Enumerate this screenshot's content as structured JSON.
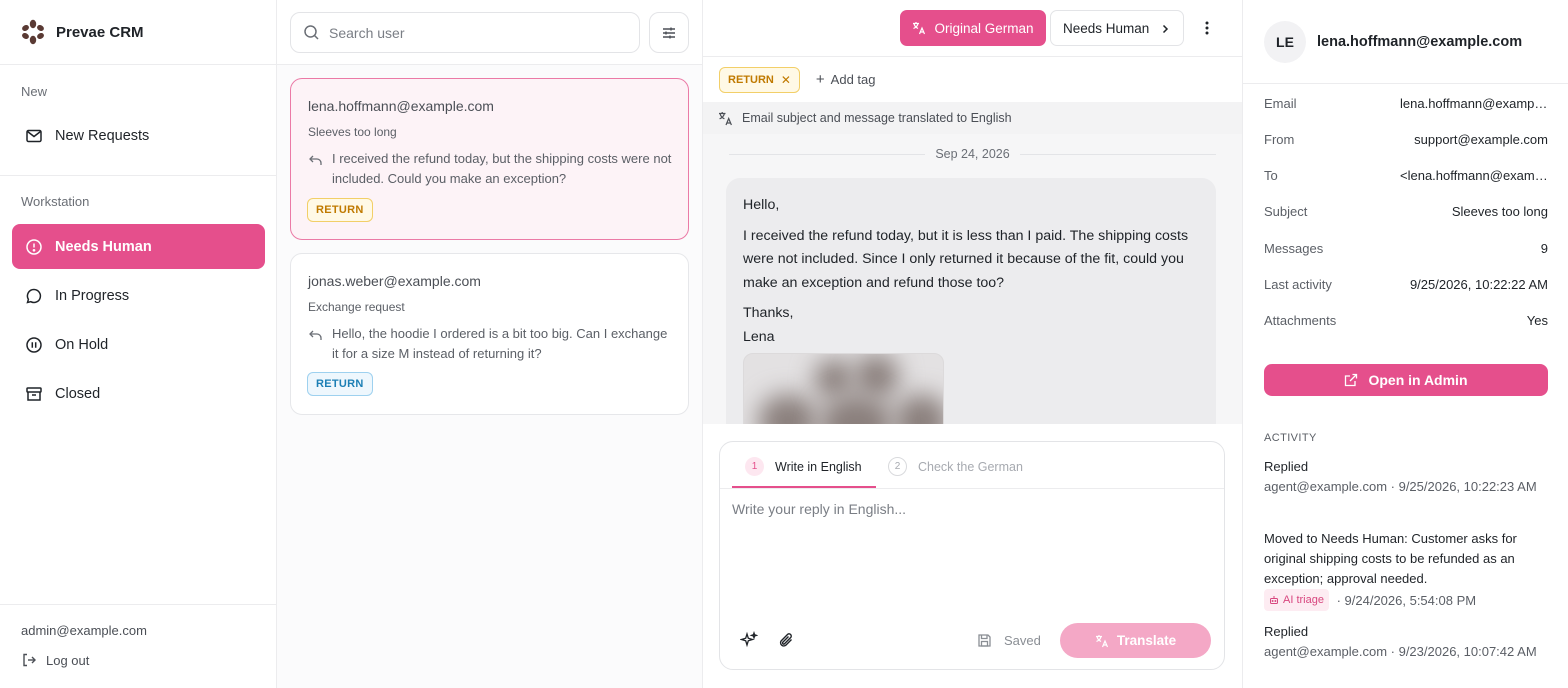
{
  "app": {
    "name": "Prevae CRM"
  },
  "sidebar": {
    "sections": {
      "new": "New",
      "workstation": "Workstation"
    },
    "items": [
      {
        "label": "New Requests",
        "icon": "mail-icon"
      },
      {
        "label": "Needs Human",
        "icon": "alert-circle-icon",
        "active": true
      },
      {
        "label": "In Progress",
        "icon": "chat-bubble-icon"
      },
      {
        "label": "On Hold",
        "icon": "pause-circle-icon"
      },
      {
        "label": "Closed",
        "icon": "archive-icon"
      }
    ],
    "user_email": "admin@example.com",
    "logout_label": "Log out"
  },
  "list": {
    "search_placeholder": "Search user",
    "conversations": [
      {
        "email": "lena.hoffmann@example.com",
        "subject": "Sleeves too long",
        "preview": "I received the refund today, but the shipping costs were not included. Could you make an exception?",
        "tag": "RETURN",
        "selected": true
      },
      {
        "email": "jonas.weber@example.com",
        "subject": "Exchange request",
        "preview": "Hello, the hoodie I ordered is a bit too big. Can I exchange it for a size M instead of returning it?",
        "tag": "RETURN",
        "selected": false
      }
    ]
  },
  "main": {
    "original_button": "Original German",
    "status_button": "Needs Human",
    "tag": "RETURN",
    "add_tag": "Add tag",
    "translation_note": "Email subject and message translated to English",
    "date": "Sep 24, 2026",
    "message": {
      "greeting": "Hello,",
      "body": "I received the refund today, but it is less than I paid. The shipping costs were not included. Since I only returned it because of the fit, could you make an exception and refund those too?",
      "closing": "Thanks,",
      "signature": "Lena"
    },
    "composer": {
      "step1_num": "1",
      "step1_label": "Write in English",
      "step2_num": "2",
      "step2_label": "Check the German",
      "placeholder": "Write your reply in English...",
      "saved_label": "Saved",
      "translate_label": "Translate"
    }
  },
  "details": {
    "avatar_initials": "LE",
    "email": "lena.hoffmann@example.com",
    "fields": [
      {
        "key": "Email",
        "value": "lena.hoffmann@example.com"
      },
      {
        "key": "From",
        "value": "support@example.com"
      },
      {
        "key": "To",
        "value": "<lena.hoffmann@example.com>"
      },
      {
        "key": "Subject",
        "value": "Sleeves too long"
      },
      {
        "key": "Messages",
        "value": "9"
      },
      {
        "key": "Last activity",
        "value": "9/25/2026, 10:22:22 AM"
      },
      {
        "key": "Attachments",
        "value": "Yes"
      }
    ],
    "open_admin": "Open in Admin",
    "activity_title": "ACTIVITY",
    "activity": [
      {
        "title": "Replied",
        "meta": "agent@example.com · 9/25/2026, 10:22:23 AM"
      },
      {
        "title": "Moved to Needs Human: Customer asks for original shipping costs to be refunded as an exception; approval needed.",
        "badge": "AI triage",
        "meta": "· 9/24/2026, 5:54:08 PM"
      },
      {
        "title": "Replied",
        "meta": "agent@example.com · 9/23/2026, 10:07:42 AM"
      }
    ]
  },
  "colors": {
    "accent": "#e54f8c",
    "accent_light": "#f4a8c6",
    "tag_yellow": "#c07a00",
    "tag_blue": "#1c7fb5"
  }
}
